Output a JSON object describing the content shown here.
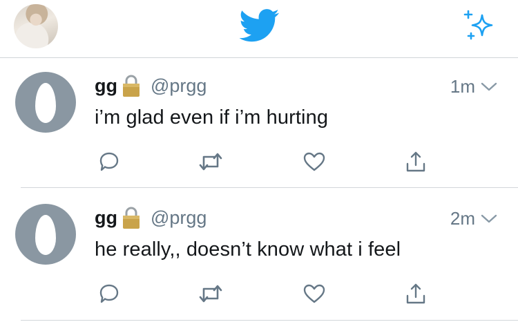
{
  "nav": {
    "profile_avatar": "profile-photo",
    "logo_icon": "twitter-bird-icon",
    "compose_icon": "sparkle-icon"
  },
  "colors": {
    "brand_blue": "#1da1f2",
    "text": "#14171a",
    "secondary_text": "#657786",
    "egg_background": "#8a97a2"
  },
  "tweets": [
    {
      "display_name": "gg",
      "handle": "@prgg",
      "timestamp": "1m",
      "text": "i’m glad even if i’m hurting",
      "protected_icon": "lock-icon"
    },
    {
      "display_name": "gg",
      "handle": "@prgg",
      "timestamp": "2m",
      "text": "he really,, doesn’t know what i feel",
      "protected_icon": "lock-icon"
    }
  ],
  "action_icons": [
    "reply-icon",
    "retweet-icon",
    "like-icon",
    "share-icon"
  ]
}
